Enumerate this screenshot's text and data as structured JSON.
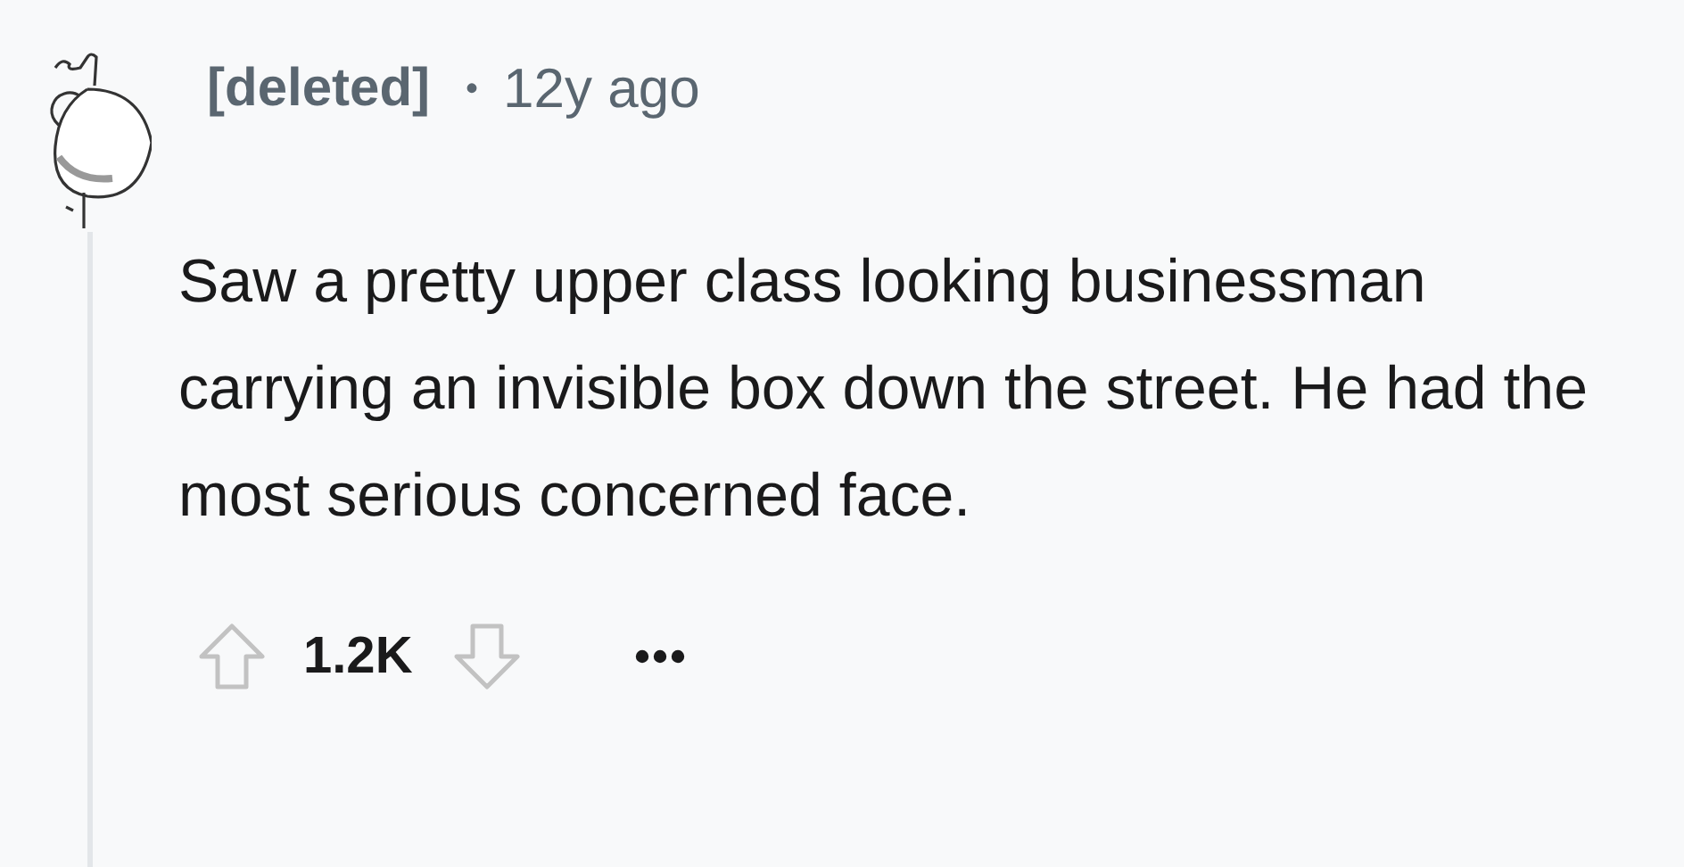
{
  "comment": {
    "author": "[deleted]",
    "separator": "•",
    "age": "12y ago",
    "body": "Saw a pretty upper class looking businessman carrying an invisible box down the street. He had the most serious concerned face.",
    "score": "1.2K"
  }
}
